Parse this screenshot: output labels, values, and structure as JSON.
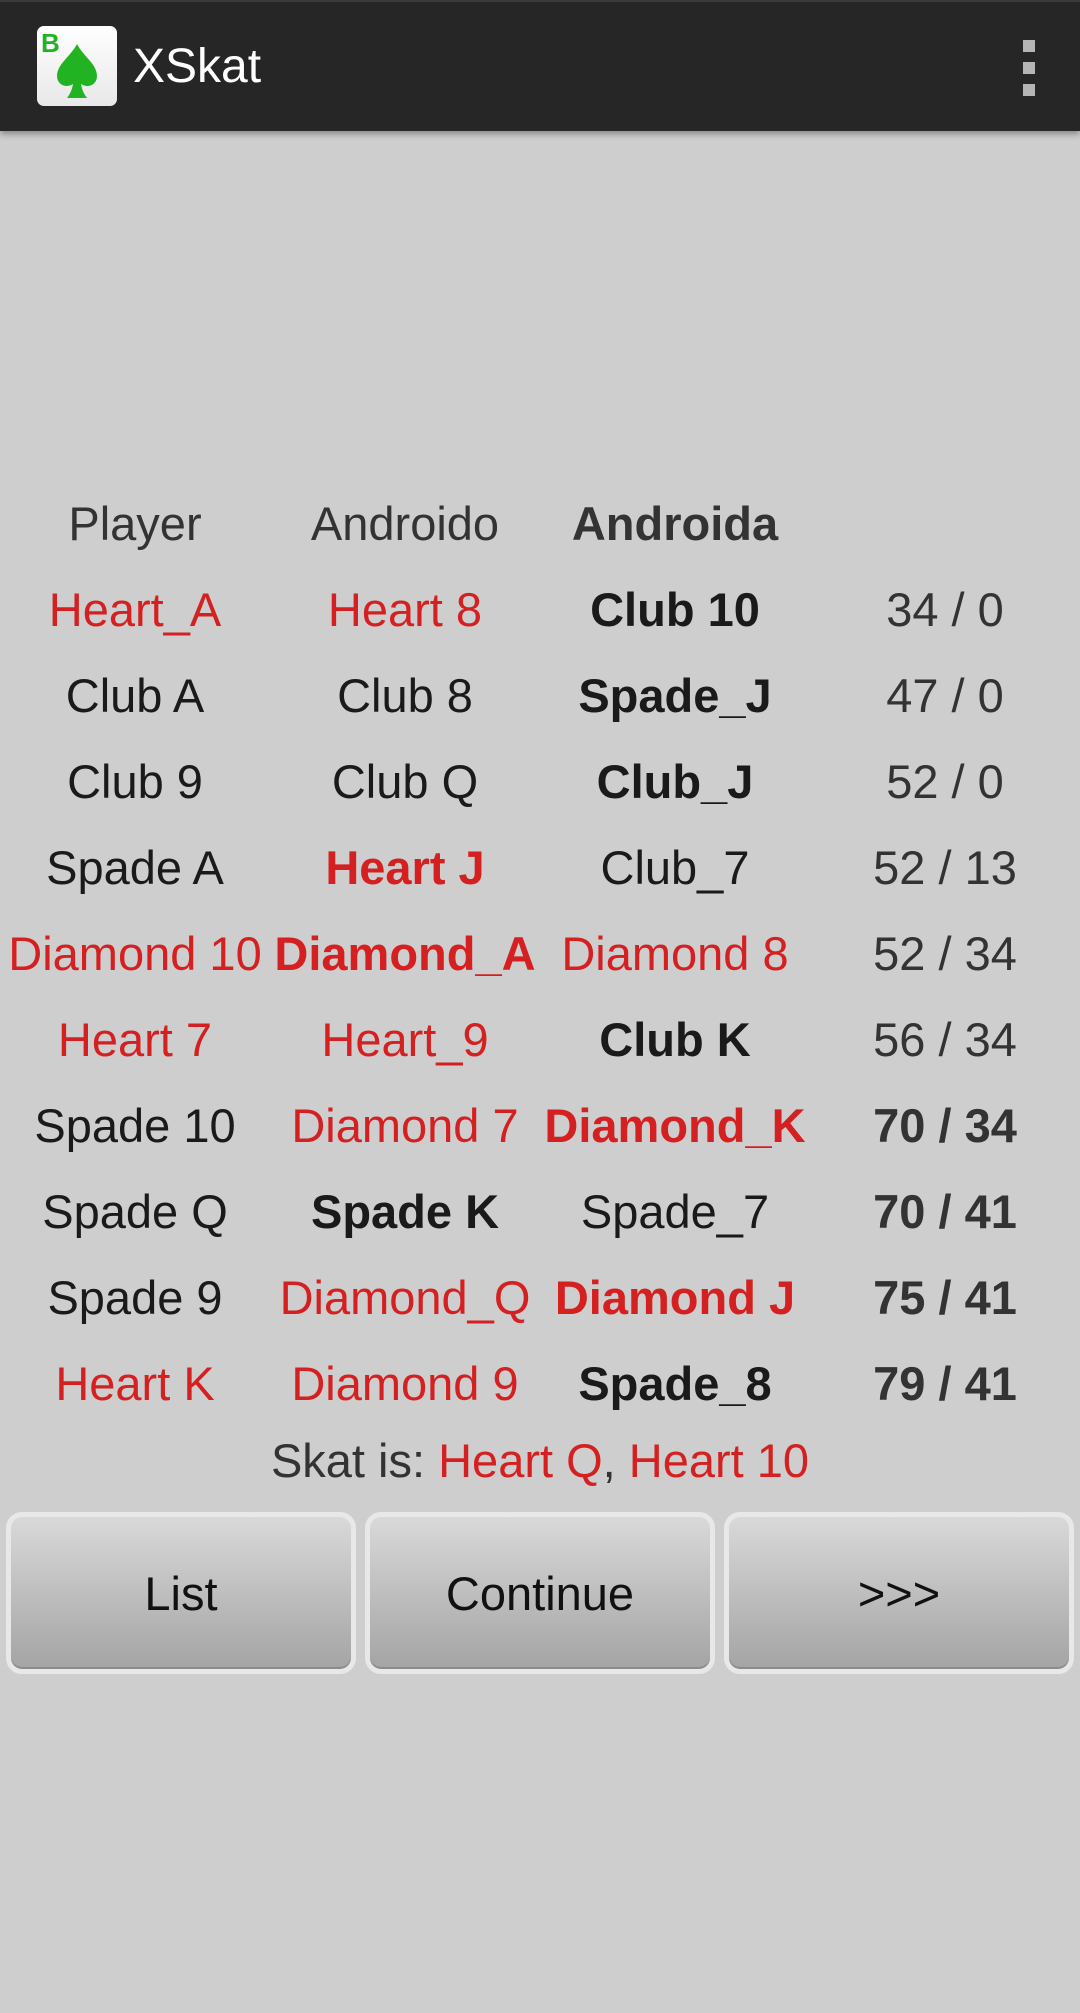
{
  "app": {
    "title": "XSkat",
    "icon": "spade-card-icon",
    "menu_icon": "overflow-menu-icon"
  },
  "colors": {
    "red_card": "#d42020",
    "black_card": "#1a1a1a",
    "appbar": "#262626",
    "background": "#cecece"
  },
  "table": {
    "headers": [
      {
        "text": "Player",
        "bold": false
      },
      {
        "text": "Androido",
        "bold": false
      },
      {
        "text": "Androida",
        "bold": true
      },
      {
        "text": "",
        "bold": false
      }
    ],
    "rows": [
      {
        "cells": [
          {
            "text": "Heart_A",
            "red": true,
            "bold": false
          },
          {
            "text": "Heart 8",
            "red": true,
            "bold": false
          },
          {
            "text": "Club 10",
            "red": false,
            "bold": true
          }
        ],
        "score": {
          "text": "34 / 0",
          "bold": false
        }
      },
      {
        "cells": [
          {
            "text": "Club A",
            "red": false,
            "bold": false
          },
          {
            "text": "Club 8",
            "red": false,
            "bold": false
          },
          {
            "text": "Spade_J",
            "red": false,
            "bold": true
          }
        ],
        "score": {
          "text": "47 / 0",
          "bold": false
        }
      },
      {
        "cells": [
          {
            "text": "Club 9",
            "red": false,
            "bold": false
          },
          {
            "text": "Club Q",
            "red": false,
            "bold": false
          },
          {
            "text": "Club_J",
            "red": false,
            "bold": true
          }
        ],
        "score": {
          "text": "52 / 0",
          "bold": false
        }
      },
      {
        "cells": [
          {
            "text": "Spade A",
            "red": false,
            "bold": false
          },
          {
            "text": "Heart J",
            "red": true,
            "bold": true
          },
          {
            "text": "Club_7",
            "red": false,
            "bold": false
          }
        ],
        "score": {
          "text": "52 / 13",
          "bold": false
        }
      },
      {
        "cells": [
          {
            "text": "Diamond 10",
            "red": true,
            "bold": false
          },
          {
            "text": "Diamond_A",
            "red": true,
            "bold": true
          },
          {
            "text": "Diamond 8",
            "red": true,
            "bold": false
          }
        ],
        "score": {
          "text": "52 / 34",
          "bold": false
        }
      },
      {
        "cells": [
          {
            "text": "Heart 7",
            "red": true,
            "bold": false
          },
          {
            "text": "Heart_9",
            "red": true,
            "bold": false
          },
          {
            "text": "Club K",
            "red": false,
            "bold": true
          }
        ],
        "score": {
          "text": "56 / 34",
          "bold": false
        }
      },
      {
        "cells": [
          {
            "text": "Spade 10",
            "red": false,
            "bold": false
          },
          {
            "text": "Diamond 7",
            "red": true,
            "bold": false
          },
          {
            "text": "Diamond_K",
            "red": true,
            "bold": true
          }
        ],
        "score": {
          "text": "70 / 34",
          "bold": true
        }
      },
      {
        "cells": [
          {
            "text": "Spade Q",
            "red": false,
            "bold": false
          },
          {
            "text": "Spade K",
            "red": false,
            "bold": true
          },
          {
            "text": "Spade_7",
            "red": false,
            "bold": false
          }
        ],
        "score": {
          "text": "70 / 41",
          "bold": true
        }
      },
      {
        "cells": [
          {
            "text": "Spade 9",
            "red": false,
            "bold": false
          },
          {
            "text": "Diamond_Q",
            "red": true,
            "bold": false
          },
          {
            "text": "Diamond J",
            "red": true,
            "bold": true
          }
        ],
        "score": {
          "text": "75 / 41",
          "bold": true
        }
      },
      {
        "cells": [
          {
            "text": "Heart K",
            "red": true,
            "bold": false
          },
          {
            "text": "Diamond 9",
            "red": true,
            "bold": false
          },
          {
            "text": "Spade_8",
            "red": false,
            "bold": true
          }
        ],
        "score": {
          "text": "79 / 41",
          "bold": true
        }
      }
    ]
  },
  "skat": {
    "prefix": "Skat is: ",
    "card1": "Heart Q",
    "separator": ", ",
    "card2": "Heart 10"
  },
  "buttons": {
    "list": "List",
    "continue": "Continue",
    "next": ">>>"
  }
}
